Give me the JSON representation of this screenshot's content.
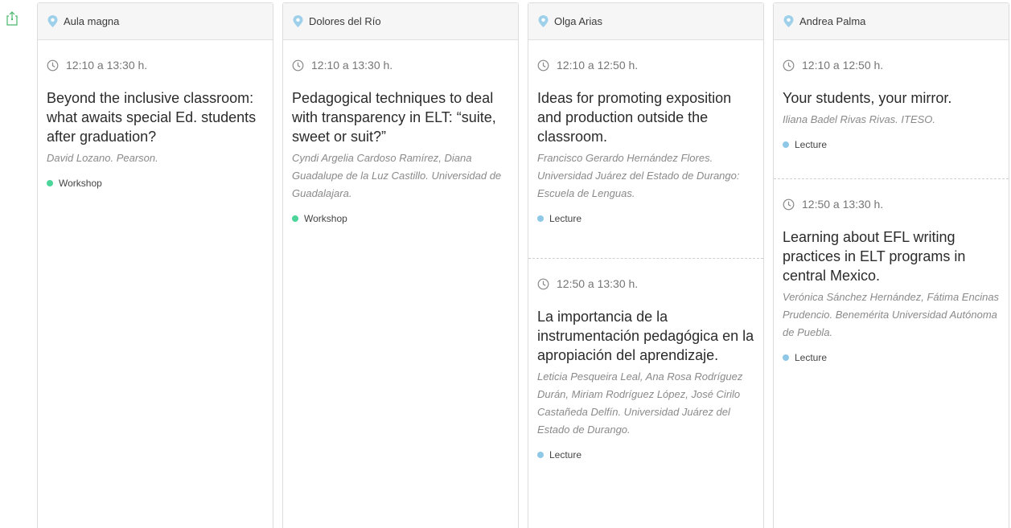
{
  "colors": {
    "workshop": "#4cd59a",
    "lecture": "#8ec8e6",
    "pin": "#9fd0ea",
    "export": "#48b86a"
  },
  "icons": {
    "export": "export-icon",
    "location": "location-pin-icon",
    "time": "clock-icon"
  },
  "columns": [
    {
      "room": "Aula magna",
      "sessions": [
        {
          "time": "12:10 a 13:30 h.",
          "title": "Beyond the inclusive classroom: what awaits special Ed. students after graduation?",
          "authors": "David Lozano. Pearson.",
          "type": "Workshop"
        }
      ]
    },
    {
      "room": "Dolores del Río",
      "sessions": [
        {
          "time": "12:10 a 13:30 h.",
          "title": "Pedagogical techniques to deal with transparency in ELT: “suite, sweet or suit?”",
          "authors": "Cyndi Argelia Cardoso Ramírez, Diana Guadalupe de la Luz Castillo. Universidad de Guadalajara.",
          "type": "Workshop"
        }
      ]
    },
    {
      "room": "Olga Arias",
      "sessions": [
        {
          "time": "12:10 a 12:50 h.",
          "title": "Ideas for promoting exposition and production outside the classroom.",
          "authors": "Francisco Gerardo Hernández Flores. Universidad Juárez del Estado de Durango: Escuela de Lenguas.",
          "type": "Lecture"
        },
        {
          "time": "12:50 a 13:30 h.",
          "title": "La importancia de la instrumentación pedagógica en la apropiación del aprendizaje.",
          "authors": "Leticia Pesqueira Leal, Ana Rosa Rodríguez Durán, Miriam Rodríguez López, José Cirilo Castañeda Delfín. Universidad Juárez del Estado de Durango.",
          "type": "Lecture"
        }
      ]
    },
    {
      "room": "Andrea Palma",
      "sessions": [
        {
          "time": "12:10 a 12:50 h.",
          "title": "Your students, your mirror.",
          "authors": "Iliana Badel Rivas Rivas. ITESO.",
          "type": "Lecture"
        },
        {
          "time": "12:50 a 13:30 h.",
          "title": "Learning about EFL writing practices in ELT programs in central Mexico.",
          "authors": "Verónica Sánchez Hernández, Fátima Encinas Prudencio. Benemérita Universidad Autónoma de Puebla.",
          "type": "Lecture"
        }
      ]
    }
  ]
}
